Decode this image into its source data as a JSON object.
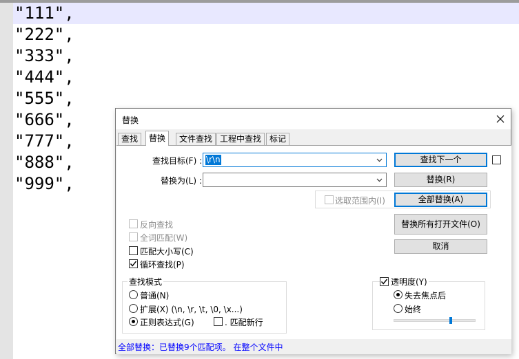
{
  "editor": {
    "lines": [
      "\"111\",",
      "\"222\",",
      "\"333\",",
      "\"444\",",
      "\"555\",",
      "\"666\",",
      "\"777\",",
      "\"888\",",
      "\"999\","
    ]
  },
  "dialog": {
    "title": "替换",
    "tabs": [
      "查找",
      "替换",
      "文件查找",
      "工程中查找",
      "标记"
    ],
    "active_tab": "替换",
    "find_label": "查找目标(F) :",
    "find_value": "\\r\\n",
    "replace_label": "替换为(L) :",
    "replace_value": "",
    "in_selection_label": "选取范围内(I)",
    "buttons": {
      "find_next": "查找下一个",
      "replace": "替换(R)",
      "replace_all": "全部替换(A)",
      "replace_all_open": "替换所有打开文件(O)",
      "cancel": "取消"
    },
    "options": {
      "backward": "反向查找",
      "whole_word": "全词匹配(W)",
      "match_case": "匹配大小写(C)",
      "wrap_around": "循环查找(P)"
    },
    "search_mode": {
      "title": "查找模式",
      "normal": "普通(N)",
      "extended": "扩展(X) (\\n, \\r, \\t, \\0, \\x...)",
      "regex": "正则表达式(G)",
      "dot_newline": ". 匹配新行",
      "selected": "regex"
    },
    "transparency": {
      "title": "透明度(Y)",
      "on_lose_focus": "失去焦点后",
      "always": "始终",
      "checked": true,
      "selected": "on_lose_focus",
      "level": 0.7
    },
    "status": "全部替换：已替换9个匹配项。 在整个文件中"
  },
  "colors": {
    "accent": "#0078d7",
    "status_text": "#0000ff",
    "current_line": "#e8e8ff"
  },
  "icons": {
    "close": "close-icon",
    "dropdown": "chevron-down-icon",
    "check": "check-icon"
  }
}
